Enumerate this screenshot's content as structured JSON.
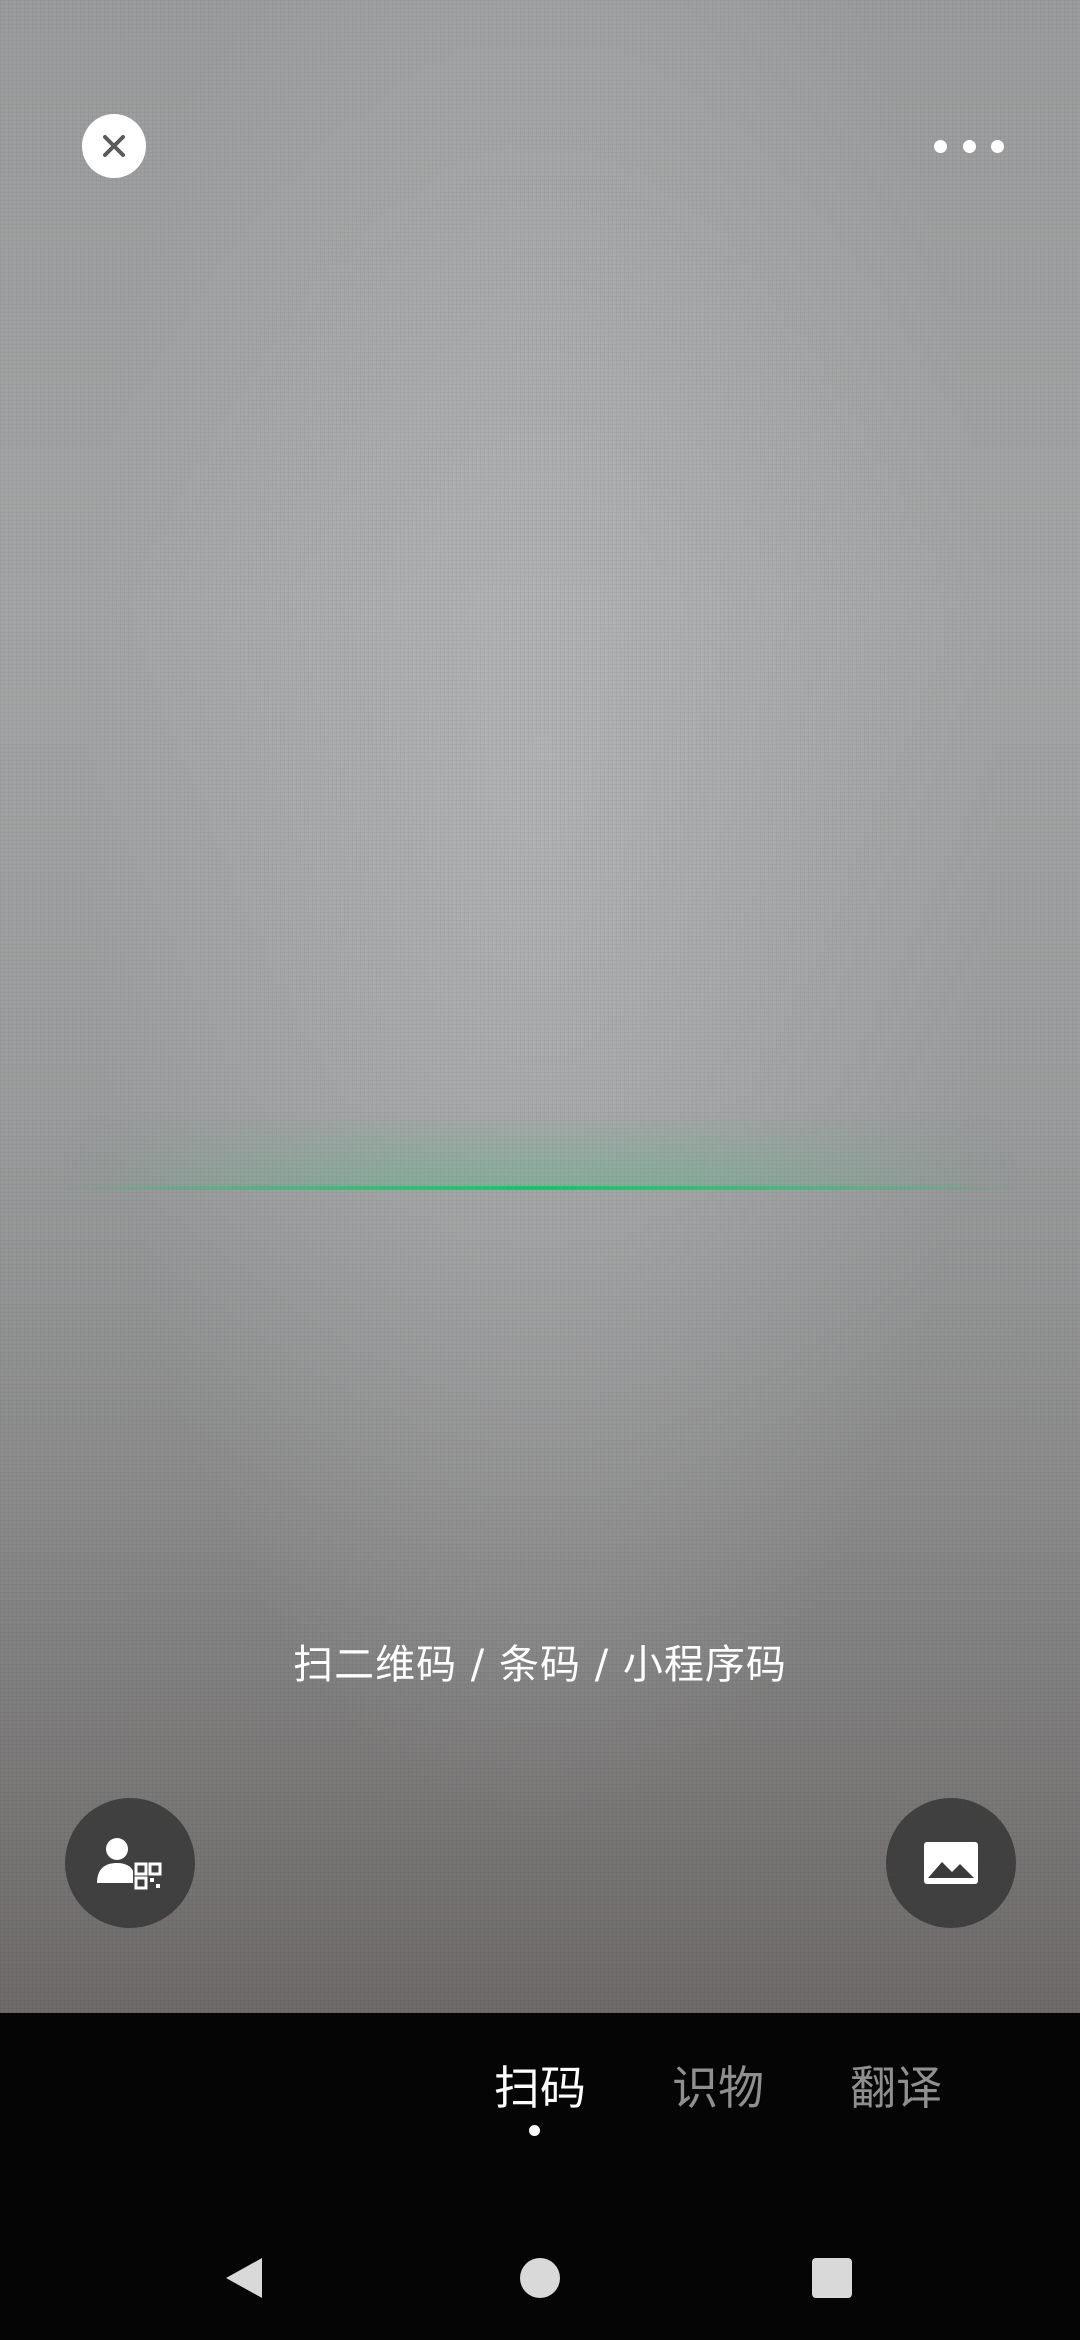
{
  "top_bar": {
    "close_icon": "close-icon",
    "more_icon": "more-horizontal-icon"
  },
  "scanner": {
    "hint_text": "扫二维码 / 条码 / 小程序码",
    "scan_line_color": "#16c46a"
  },
  "actions": {
    "my_code_icon": "my-qr-code-icon",
    "album_icon": "image-album-icon"
  },
  "tabs": [
    {
      "label": "扫码",
      "active": true
    },
    {
      "label": "识物",
      "active": false
    },
    {
      "label": "翻译",
      "active": false
    }
  ],
  "nav": {
    "back_icon": "back-triangle-icon",
    "home_icon": "home-circle-icon",
    "recent_icon": "recent-square-icon"
  }
}
